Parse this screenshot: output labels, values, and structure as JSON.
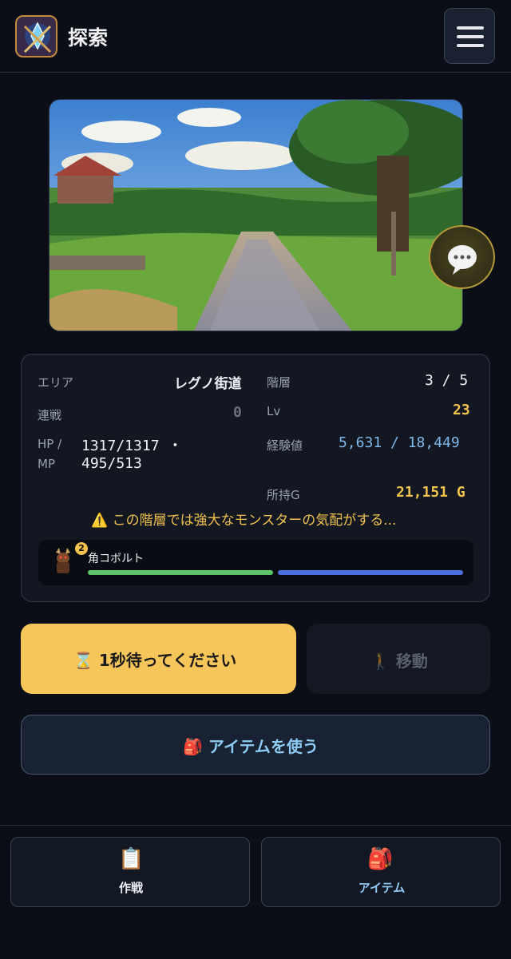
{
  "header": {
    "title": "探索"
  },
  "stats": {
    "area_label": "エリア",
    "area_value": "レグノ街道",
    "floor_label": "階層",
    "floor_value": "3 / 5",
    "streak_label": "連戦",
    "streak_value": "0",
    "lv_label": "Lv",
    "lv_value": "23",
    "hpmp_label_1": "HP /",
    "hpmp_label_2": "MP",
    "hp_value": "1317/1317 ・",
    "mp_value": "495/513",
    "exp_label": "経験値",
    "exp_value": "5,631 / 18,449",
    "gold_label": "所持G",
    "gold_value": "21,151 G"
  },
  "warning": {
    "icon": "warning-icon",
    "text": "この階層では強大なモンスターの気配がする..."
  },
  "monster": {
    "name": "角コボルト",
    "badge": "2",
    "hp_fraction": 1.0,
    "mp_fraction": 1.0,
    "hp_color": "#5ec46a",
    "mp_color": "#4a6fe0"
  },
  "actions": {
    "wait_label": "1秒待ってください",
    "wait_icon": "hourglass-icon",
    "move_label": "移動",
    "move_icon": "walking-icon",
    "item_label": "アイテムを使う",
    "item_icon": "backpack-icon"
  },
  "nav": {
    "strategy_label": "作戦",
    "items_label": "アイテム"
  },
  "colors": {
    "accent_gold": "#f2c14e",
    "exp_blue": "#7fb8ea",
    "item_text": "#8ecbf5",
    "wait_bg": "#f6c65a"
  }
}
